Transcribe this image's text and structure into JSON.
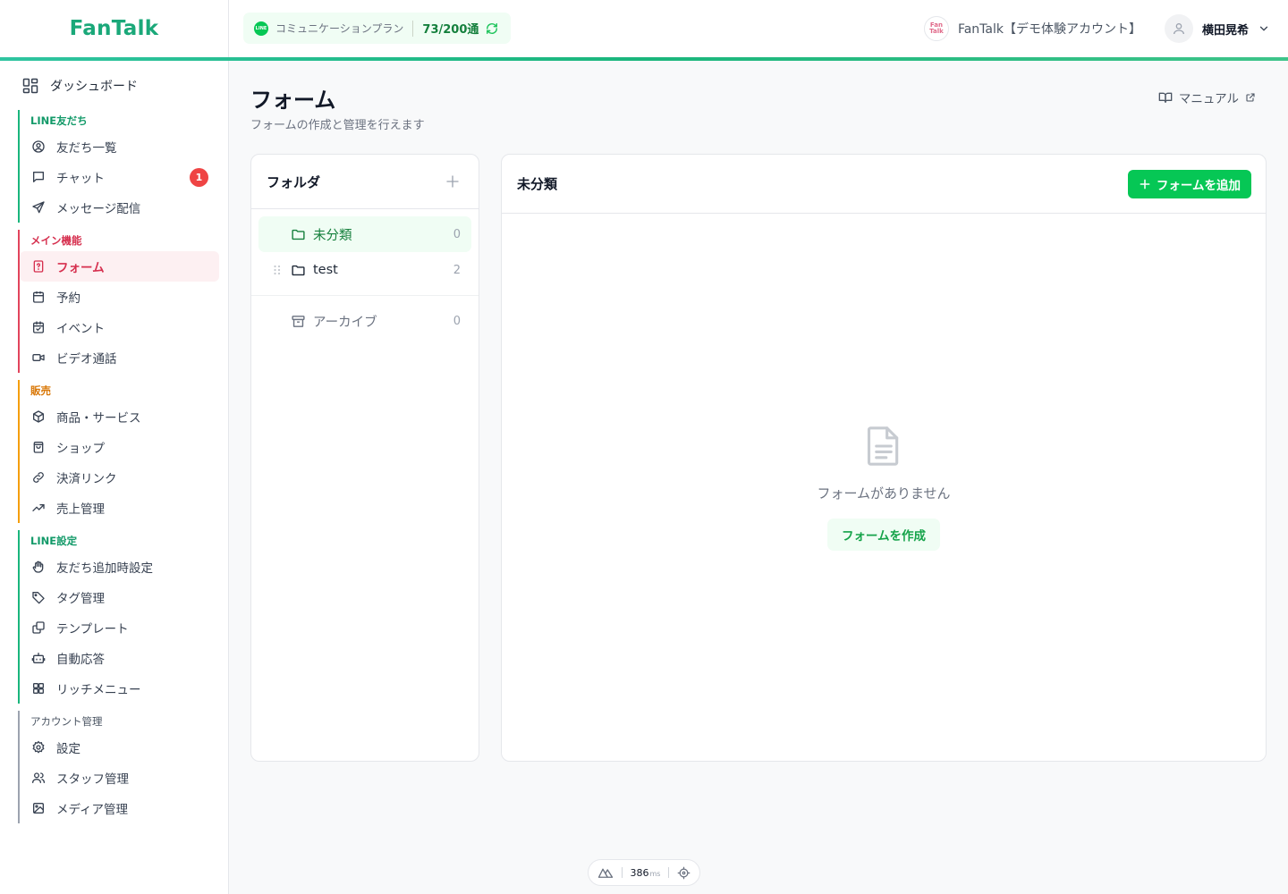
{
  "header": {
    "logo": "FanTalk",
    "plan": {
      "line_icon": "LINE",
      "label": "コミュニケーションプラン",
      "count": "73/200通"
    },
    "account": {
      "avatar_text": "Fan Talk",
      "name": "FanTalk【デモ体験アカウント】"
    },
    "user": {
      "name": "横田晃希"
    }
  },
  "sidebar": {
    "dashboard": "ダッシュボード",
    "groups": [
      {
        "title": "LINE友だち",
        "color": "#1ab67c",
        "items": [
          {
            "label": "友だち一覧",
            "icon": "user-circle-icon"
          },
          {
            "label": "チャット",
            "icon": "chat-icon",
            "badge": "1"
          },
          {
            "label": "メッセージ配信",
            "icon": "send-icon"
          }
        ]
      },
      {
        "title": "メイン機能",
        "color": "#e2445c",
        "items": [
          {
            "label": "フォーム",
            "icon": "form-icon",
            "active": true
          },
          {
            "label": "予約",
            "icon": "calendar-icon"
          },
          {
            "label": "イベント",
            "icon": "calendar-check-icon"
          },
          {
            "label": "ビデオ通話",
            "icon": "video-icon"
          }
        ]
      },
      {
        "title": "販売",
        "color": "#f59e0b",
        "items": [
          {
            "label": "商品・サービス",
            "icon": "package-icon"
          },
          {
            "label": "ショップ",
            "icon": "shopping-bag-icon"
          },
          {
            "label": "決済リンク",
            "icon": "link-icon"
          },
          {
            "label": "売上管理",
            "icon": "trending-up-icon"
          }
        ]
      },
      {
        "title": "LINE設定",
        "color": "#1ab67c",
        "items": [
          {
            "label": "友だち追加時設定",
            "icon": "hand-icon"
          },
          {
            "label": "タグ管理",
            "icon": "tag-icon"
          },
          {
            "label": "テンプレート",
            "icon": "template-icon"
          },
          {
            "label": "自動応答",
            "icon": "bot-icon"
          },
          {
            "label": "リッチメニュー",
            "icon": "grid-icon"
          }
        ]
      },
      {
        "title": "アカウント管理",
        "color": "#9ca3af",
        "items": [
          {
            "label": "設定",
            "icon": "gear-icon"
          },
          {
            "label": "スタッフ管理",
            "icon": "users-icon"
          },
          {
            "label": "メディア管理",
            "icon": "image-icon"
          }
        ]
      }
    ]
  },
  "page": {
    "title": "フォーム",
    "subtitle": "フォームの作成と管理を行えます",
    "manual": "マニュアル"
  },
  "folders": {
    "title": "フォルダ",
    "items": [
      {
        "name": "未分類",
        "count": "0",
        "selected": true
      },
      {
        "name": "test",
        "count": "2",
        "selected": false
      }
    ],
    "archive": {
      "name": "アーカイブ",
      "count": "0"
    }
  },
  "content": {
    "title": "未分類",
    "add_button": "フォームを追加",
    "empty_text": "フォームがありません",
    "create_button": "フォームを作成"
  },
  "perf": {
    "value": "386",
    "unit": "ms"
  },
  "colors": {
    "brand": "#06c755",
    "accent_red": "#d6304f",
    "accent_green": "#1ab67c"
  }
}
